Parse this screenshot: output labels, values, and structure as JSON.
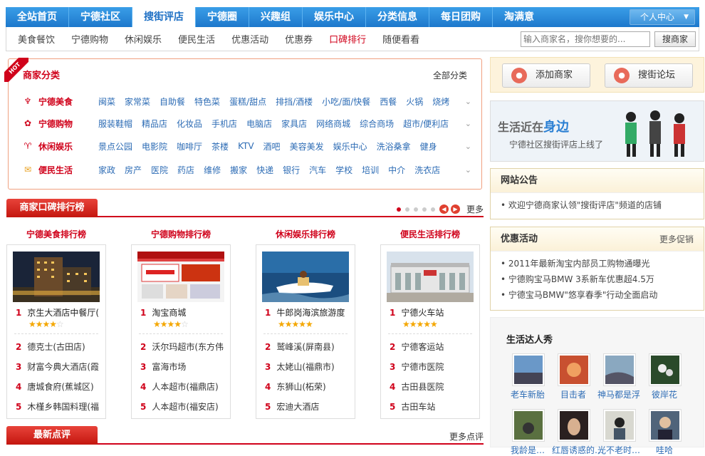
{
  "topnav": {
    "items": [
      "全站首页",
      "宁德社区",
      "搜街评店",
      "宁德圈",
      "兴趣组",
      "娱乐中心",
      "分类信息",
      "每日团购",
      "淘满意"
    ],
    "active_index": 2,
    "user_center": "个人中心"
  },
  "subnav": {
    "items": [
      "美食餐饮",
      "宁德购物",
      "休闲娱乐",
      "便民生活",
      "优惠活动",
      "优惠券",
      "口碑排行",
      "随便看看"
    ],
    "highlight_index": 6,
    "search_placeholder": "输入商家名，搜你想要的...",
    "search_button": "搜商家"
  },
  "categories": {
    "badge": "HOT",
    "title": "商家分类",
    "all": "全部分类",
    "rows": [
      {
        "icon": "cutlery-icon",
        "name": "宁德美食",
        "items": [
          "闽菜",
          "家常菜",
          "自助餐",
          "特色菜",
          "蛋糕/甜点",
          "排挡/酒楼",
          "小吃/面/快餐",
          "西餐",
          "火锅",
          "烧烤"
        ]
      },
      {
        "icon": "shopping-icon",
        "name": "宁德购物",
        "items": [
          "服装鞋帽",
          "精品店",
          "化妆品",
          "手机店",
          "电脑店",
          "家具店",
          "网络商城",
          "综合商场",
          "超市/便利店"
        ]
      },
      {
        "icon": "cocktail-icon",
        "name": "休闲娱乐",
        "items": [
          "景点公园",
          "电影院",
          "咖啡厅",
          "茶楼",
          "KTV",
          "酒吧",
          "美容美发",
          "娱乐中心",
          "洗浴桑拿",
          "健身"
        ]
      },
      {
        "icon": "mail-icon",
        "name": "便民生活",
        "items": [
          "家政",
          "房产",
          "医院",
          "药店",
          "维修",
          "搬家",
          "快递",
          "银行",
          "汽车",
          "学校",
          "培训",
          "中介",
          "洗衣店"
        ]
      }
    ]
  },
  "ranking": {
    "title": "商家口碑排行榜",
    "more": "更多",
    "columns": [
      {
        "title": "宁德美食排行榜",
        "top": "京生大酒店中餐厅(",
        "stars": 4,
        "items": [
          "德克士(古田店)",
          "财富今典大酒店(霞",
          "唐城食府(蕉城区)",
          "木槿乡韩国料理(福"
        ]
      },
      {
        "title": "宁德购物排行榜",
        "top": "淘宝商城",
        "stars": 4,
        "items": [
          "沃尔玛超市(东方伟",
          "富海市场",
          "人本超市(福鼎店)",
          "人本超市(福安店)"
        ]
      },
      {
        "title": "休闲娱乐排行榜",
        "top": "牛郎岗海滨旅游度",
        "stars": 5,
        "items": [
          "鹫峰溪(屏南县)",
          "太姥山(福鼎市)",
          "东狮山(柘荣)",
          "宏迪大酒店"
        ]
      },
      {
        "title": "便民生活排行榜",
        "top": "宁德火车站",
        "stars": 5,
        "items": [
          "宁德客运站",
          "宁德市医院",
          "古田县医院",
          "古田车站"
        ]
      }
    ]
  },
  "reviews": {
    "title": "最新点评",
    "more": "更多点评"
  },
  "side": {
    "add_shop": "添加商家",
    "forum": "搜街论坛",
    "banner_t1a": "生活近在",
    "banner_t1b": "身边",
    "banner_t2": "宁德社区搜街评店上线了",
    "notice_title": "网站公告",
    "notice_items": [
      "欢迎宁德商家认领\"搜街评店\"频道的店铺"
    ],
    "promo_title": "优惠活动",
    "promo_more": "更多促销",
    "promo_items": [
      "2011年最新淘宝内部员工购物通曝光",
      "宁德购宝马BMW 3系新车优惠超4.5万",
      "宁德宝马BMW\"悠享春季\"行动全面启动"
    ],
    "talent_title": "生活达人秀",
    "talents": [
      "老车新胎",
      "目击者",
      "神马都是浮",
      "彼岸花",
      "我龄是…",
      "红唇诱惑的…",
      "光不老时…",
      "哇哈"
    ]
  }
}
